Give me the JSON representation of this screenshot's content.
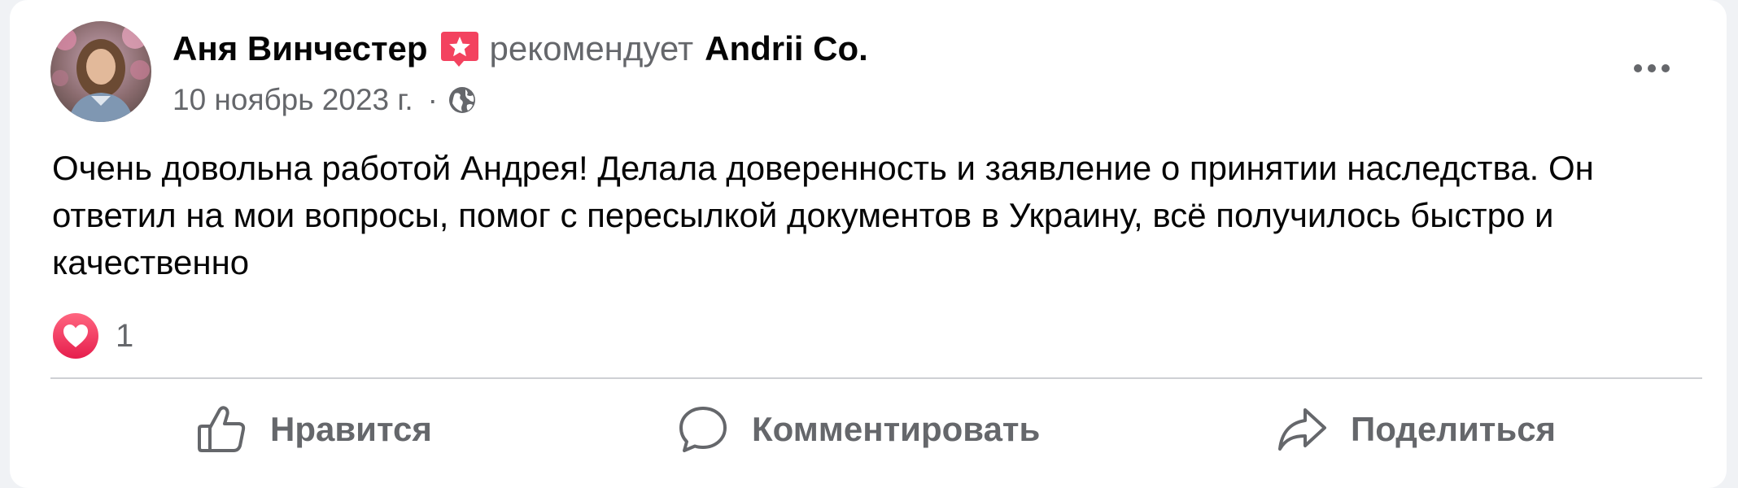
{
  "post": {
    "author": "Аня Винчестер",
    "recommends_text": "рекомендует",
    "page_name": "Andrii Co.",
    "date": "10 ноябрь 2023 г.",
    "separator": "·",
    "text": "Очень довольна работой Андрея! Делала доверенность и заявление о принятии наследства. Он ответил на мои вопросы, помог с пересылкой документов в Украину, всё получилось быстро и качественно",
    "reaction_count": "1"
  },
  "actions": {
    "like": "Нравится",
    "comment": "Комментировать",
    "share": "Поделиться"
  },
  "icons": {
    "avatar": "avatar-photo",
    "recommendation": "recommendation-star-icon",
    "privacy": "globe-icon",
    "more": "more-options-icon",
    "reaction": "love-heart-icon",
    "like": "thumbs-up-icon",
    "comment": "comment-bubble-icon",
    "share": "share-arrow-icon"
  },
  "colors": {
    "primary_text": "#050505",
    "secondary_text": "#65676b",
    "recommend_badge": "#f3425f",
    "love_reaction": "#f33e58",
    "divider": "#ced0d4"
  }
}
